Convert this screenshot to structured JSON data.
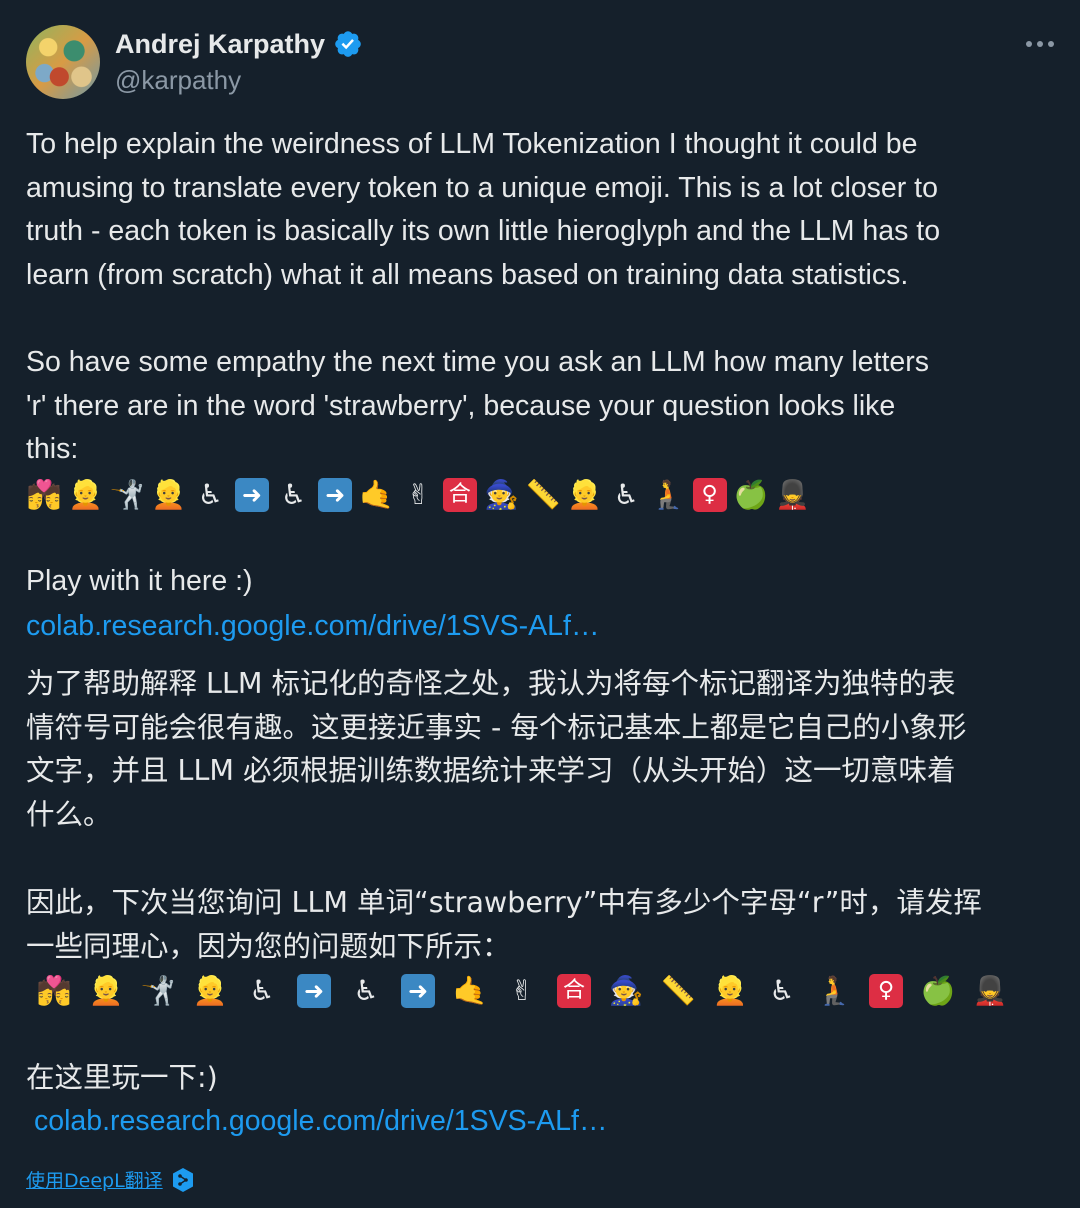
{
  "author": {
    "name": "Andrej Karpathy",
    "handle": "@karpathy",
    "verified": true
  },
  "tweet": {
    "en_paragraph_1": "To help explain the weirdness of LLM Tokenization I thought it could be\namusing to translate every token to a unique emoji. This is a lot closer to\ntruth - each token is basically its own little hieroglyph and the LLM has to\nlearn (from scratch) what it all means based on training data statistics.",
    "en_paragraph_2": "So have some empathy the next time you ask an LLM how many letters\n'r' there are in the word 'strawberry', because your question looks like\nthis:",
    "en_play": "Play with it here :)",
    "en_link": "colab.research.google.com/drive/1SVS-ALf…",
    "zh_paragraph_1": "为了帮助解释 LLM 标记化的奇怪之处，我认为将每个标记翻译为独特的表\n情符号可能会很有趣。这更接近事实 - 每个标记基本上都是它自己的小象形\n文字，并且 LLM 必须根据训练数据统计来学习（从头开始）这一切意味着\n什么。",
    "zh_paragraph_2": "因此，下次当您询问 LLM 单词“strawberry”中有多少个字母“r”时，请发挥\n一些同理心，因为您的问题如下所示：",
    "zh_play": "在这里玩一下:)",
    "zh_link": "colab.research.google.com/drive/1SVS-ALf…",
    "emoji_tokens": [
      "couple-with-heart",
      "person-blond",
      "person-fencing",
      "woman-blond",
      "person-in-wheelchair",
      "right-arrow",
      "person-in-wheelchair",
      "right-arrow",
      "call-me-hand",
      "victory-hand",
      "japanese-passing-grade-button",
      "woman-mage",
      "straight-ruler",
      "woman-blond",
      "person-in-wheelchair",
      "person-kneeling",
      "female-sign",
      "green-apple",
      "guard"
    ]
  },
  "translate_link": "使用DeepL翻译",
  "colors": {
    "background": "#15202b",
    "text": "#e7e9ea",
    "secondary": "#8b98a5",
    "link": "#1d9bf0",
    "verified": "#1d9bf0"
  }
}
